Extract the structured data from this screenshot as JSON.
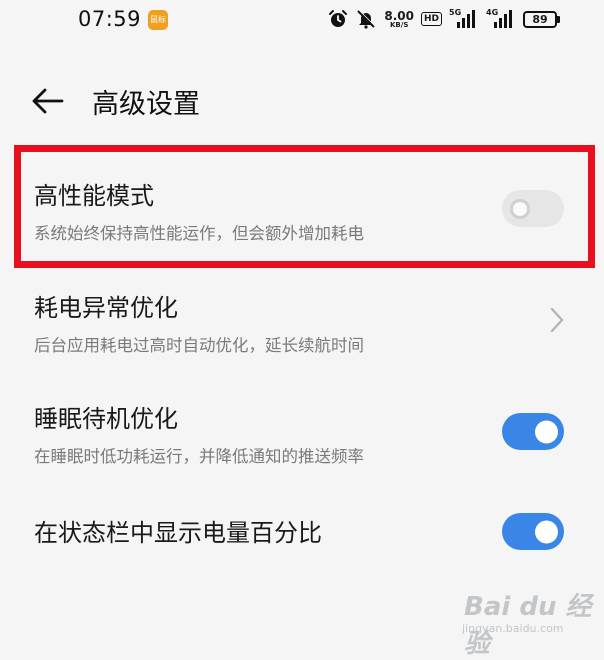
{
  "status_bar": {
    "time": "07:59",
    "app_badge": "鼠标",
    "net_speed_value": "8.00",
    "net_speed_unit": "KB/S",
    "hd_label": "HD",
    "sim1_label": "5G",
    "sim2_label": "4G",
    "battery": "89"
  },
  "header": {
    "title": "高级设置",
    "back_icon": "arrow-left-icon"
  },
  "settings": [
    {
      "title": "高性能模式",
      "description": "系统始终保持高性能运作，但会额外增加耗电",
      "control": "toggle",
      "enabled": false,
      "highlighted": true
    },
    {
      "title": "耗电异常优化",
      "description": "后台应用耗电过高时自动优化，延长续航时间",
      "control": "chevron"
    },
    {
      "title": "睡眠待机优化",
      "description": "在睡眠时低功耗运行，并降低通知的推送频率",
      "control": "toggle",
      "enabled": true
    },
    {
      "title": "在状态栏中显示电量百分比",
      "control": "toggle",
      "enabled": true
    }
  ],
  "watermark": {
    "brand": "Bai du 经验",
    "url": "jingyan.baidu.com"
  },
  "colors": {
    "accent": "#3a86e6",
    "highlight": "#e8101f",
    "background": "#f5f5f5"
  }
}
